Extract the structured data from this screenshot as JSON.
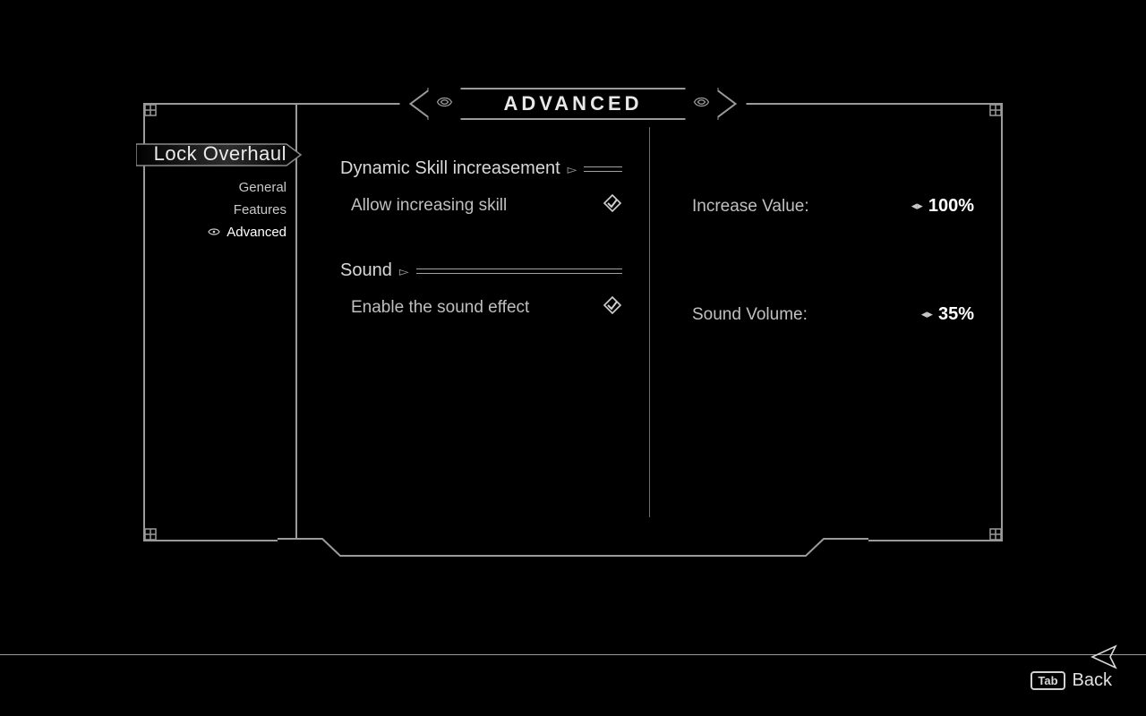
{
  "title": "ADVANCED",
  "sidebar": {
    "mod_name": "Lock Overhaul",
    "items": [
      {
        "label": "General"
      },
      {
        "label": "Features"
      },
      {
        "label": "Advanced",
        "active": true
      }
    ]
  },
  "sections": {
    "skill": {
      "header": "Dynamic Skill increasement",
      "toggle_label": "Allow increasing skill",
      "value_label": "Increase Value:",
      "value": "100%"
    },
    "sound": {
      "header": "Sound",
      "toggle_label": "Enable the sound effect",
      "value_label": "Sound Volume:",
      "value": "35%"
    }
  },
  "footer": {
    "key": "Tab",
    "label": "Back"
  }
}
